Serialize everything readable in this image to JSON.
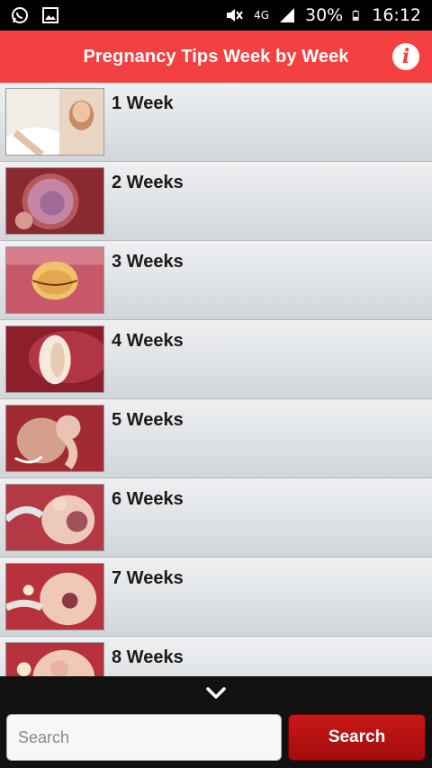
{
  "status_bar": {
    "network": "4G",
    "battery": "30%",
    "time": "16:12"
  },
  "header": {
    "title": "Pregnancy Tips Week by Week",
    "info_icon": "info-icon"
  },
  "weeks": [
    {
      "label": "1 Week"
    },
    {
      "label": "2 Weeks"
    },
    {
      "label": "3 Weeks"
    },
    {
      "label": "4 Weeks"
    },
    {
      "label": "5 Weeks"
    },
    {
      "label": "6 Weeks"
    },
    {
      "label": "7 Weeks"
    },
    {
      "label": "8 Weeks"
    }
  ],
  "footer": {
    "search_placeholder": "Search",
    "search_button": "Search",
    "collapse_icon": "chevron-down-icon"
  },
  "colors": {
    "header_bg": "#f44040",
    "button_bg": "#b01010",
    "row_bg": "#e2e4e7"
  }
}
